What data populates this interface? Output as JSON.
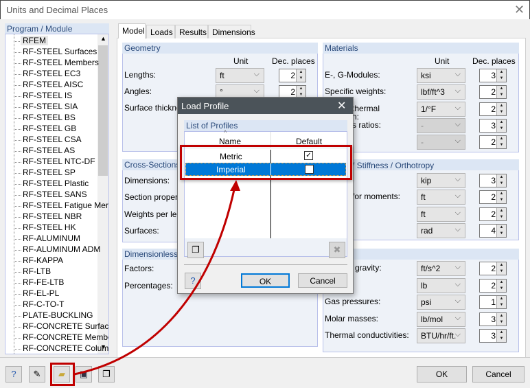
{
  "window": {
    "title": "Units and Decimal Places",
    "close_icon": "close-icon"
  },
  "left": {
    "header": "Program / Module",
    "items": [
      "RFEM",
      "RF-STEEL Surfaces",
      "RF-STEEL Members",
      "RF-STEEL EC3",
      "RF-STEEL AISC",
      "RF-STEEL IS",
      "RF-STEEL SIA",
      "RF-STEEL BS",
      "RF-STEEL GB",
      "RF-STEEL CSA",
      "RF-STEEL AS",
      "RF-STEEL NTC-DF",
      "RF-STEEL SP",
      "RF-STEEL Plastic",
      "RF-STEEL SANS",
      "RF-STEEL Fatigue Mer",
      "RF-STEEL NBR",
      "RF-STEEL HK",
      "RF-ALUMINUM",
      "RF-ALUMINUM ADM",
      "RF-KAPPA",
      "RF-LTB",
      "RF-FE-LTB",
      "RF-EL-PL",
      "RF-C-TO-T",
      "PLATE-BUCKLING",
      "RF-CONCRETE Surfac",
      "RF-CONCRETE Membe",
      "RF-CONCRETE Colum"
    ]
  },
  "tabs": [
    "Model",
    "Loads",
    "Results",
    "Dimensions"
  ],
  "col": {
    "unit": "Unit",
    "dec": "Dec. places"
  },
  "geometry": {
    "title": "Geometry",
    "rows": [
      {
        "label": "Lengths:",
        "unit": "ft",
        "dec": "2"
      },
      {
        "label": "Angles:",
        "unit": "°",
        "dec": "2"
      },
      {
        "label": "Surface thicknes"
      }
    ]
  },
  "cross": {
    "title": "Cross-Sections",
    "rows": [
      "Dimensions:",
      "Section propertie",
      "Weights per leng",
      "Surfaces:"
    ]
  },
  "dimless": {
    "title": "Dimensionless",
    "rows": [
      "Factors:",
      "Percentages:"
    ]
  },
  "materials": {
    "title": "Materials",
    "rows": [
      {
        "label": "E-, G-Modules:",
        "unit": "ksi",
        "dec": "3"
      },
      {
        "label": "Specific weights:",
        "unit": "lbf/ft^3",
        "dec": "2"
      },
      {
        "label": "thermal\nn:",
        "unit": "1/°F",
        "dec": "2"
      },
      {
        "label": "s ratios:",
        "unit": "-",
        "dec": "3",
        "disabled": true
      },
      {
        "label": "",
        "unit": "-",
        "dec": "2",
        "disabled": true
      }
    ]
  },
  "stiffness": {
    "title": "/ Stiffness / Orthotropy",
    "rows": [
      {
        "label": "",
        "unit": "kip",
        "dec": "3"
      },
      {
        "label": "for moments:",
        "unit": "ft",
        "dec": "2"
      },
      {
        "label": "",
        "unit": "ft",
        "dec": "2"
      },
      {
        "label": "",
        "unit": "rad",
        "dec": "4"
      }
    ]
  },
  "other": {
    "rows": [
      {
        "label": "gravity:",
        "unit": "ft/s^2",
        "dec": "2"
      },
      {
        "label": "",
        "unit": "lb",
        "dec": "2"
      },
      {
        "label": "Gas pressures:",
        "unit": "psi",
        "dec": "1"
      },
      {
        "label": "Molar masses:",
        "unit": "lb/mol",
        "dec": "3"
      },
      {
        "label": "Thermal conductivities:",
        "unit": "BTU/hr/ft.",
        "dec": "3"
      }
    ]
  },
  "footer": {
    "ok": "OK",
    "cancel": "Cancel",
    "icons": [
      "help-icon",
      "edit-icon",
      "load-profile-folder-icon",
      "save-icon",
      "copy-icon"
    ]
  },
  "dialog": {
    "title": "Load Profile",
    "group": "List of Profiles",
    "col_name": "Name",
    "col_default": "Default",
    "rows": [
      {
        "name": "Metric",
        "default": true
      },
      {
        "name": "Imperial",
        "default": false,
        "selected": true
      }
    ],
    "ok": "OK",
    "cancel": "Cancel"
  },
  "colors": {
    "selection": "#0078d7",
    "highlight": "#c00000",
    "dialog_title": "#4b5359"
  }
}
